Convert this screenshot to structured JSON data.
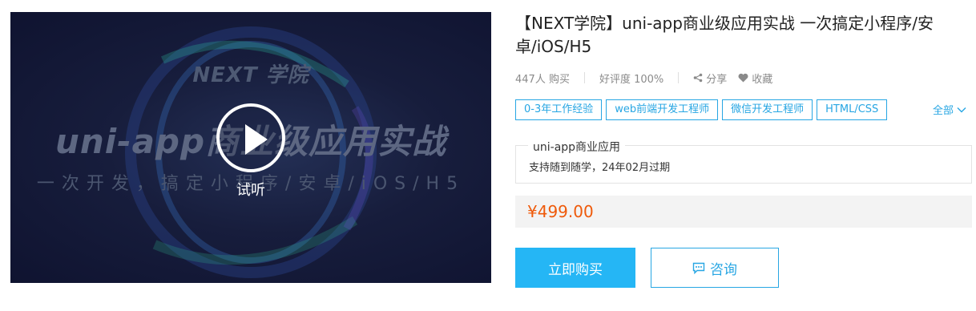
{
  "cover": {
    "brand": "NEXT 学院",
    "title": "uni-app商业级应用实战",
    "subtitle": "一次开发，搞定小程序/安卓/iOS/H5",
    "play_label": "试听"
  },
  "course": {
    "title": "【NEXT学院】uni-app商业级应用实战 一次搞定小程序/安卓/iOS/H5",
    "buyers": "447人 购买",
    "rating": "好评度 100%",
    "share_label": "分享",
    "favorite_label": "收藏"
  },
  "tags": [
    "0-3年工作经验",
    "web前端开发工程师",
    "微信开发工程师",
    "HTML/CSS"
  ],
  "all_label": "全部",
  "package": {
    "name": "uni-app商业应用",
    "description": "支持随到随学，24年02月过期"
  },
  "price": "¥499.00",
  "actions": {
    "buy_label": "立即购买",
    "consult_label": "咨询"
  },
  "colors": {
    "accent": "#27a6e3",
    "buy_button": "#25b6f5",
    "price": "#ef5a0a"
  },
  "icons": {
    "share": "share-icon",
    "favorite": "heart-icon",
    "chevron": "chevron-down-icon",
    "chat": "chat-icon",
    "play": "play-icon"
  }
}
